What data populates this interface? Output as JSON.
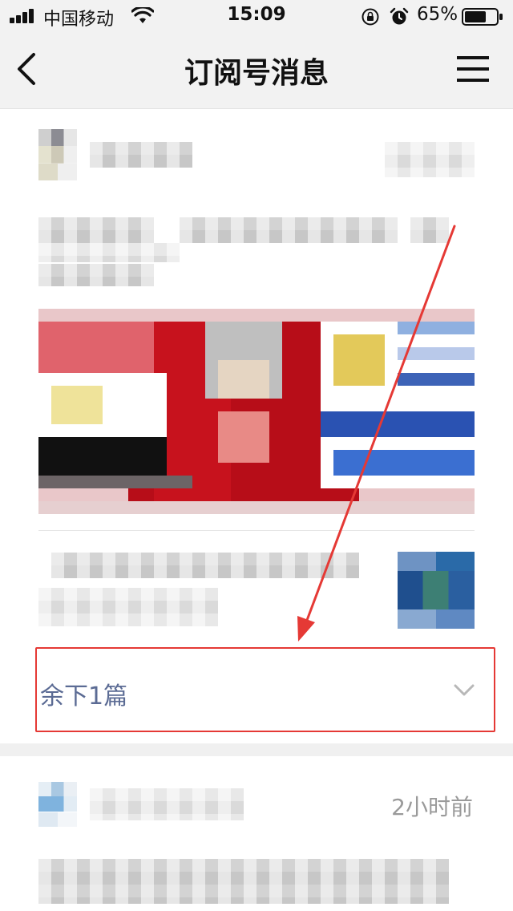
{
  "status_bar": {
    "carrier": "中国移动",
    "time": "15:09",
    "battery": "65%",
    "battery_level": 0.65
  },
  "nav": {
    "title": "订阅号消息"
  },
  "feed": {
    "first_card": {
      "remaining_label": "余下1篇"
    },
    "second_card": {
      "time_ago": "2小时前"
    }
  },
  "colors": {
    "highlight_box": "#e53935",
    "arrow": "#e53935",
    "link_text": "#5b6b94"
  }
}
